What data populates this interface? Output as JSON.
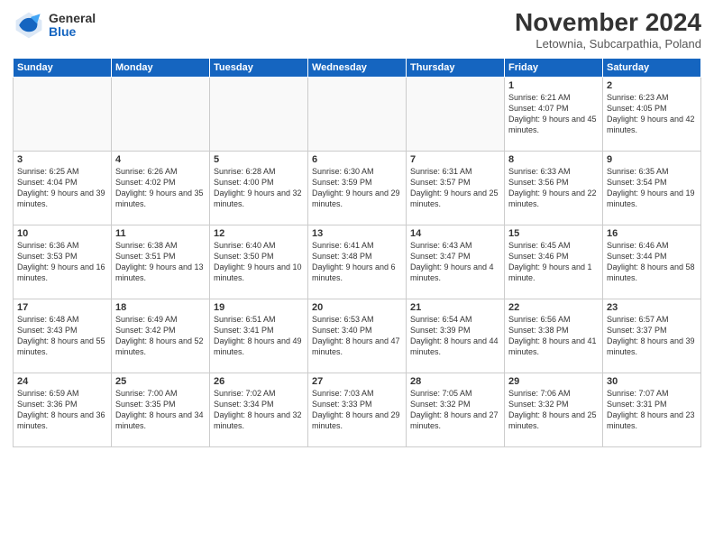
{
  "logo": {
    "general": "General",
    "blue": "Blue"
  },
  "header": {
    "month": "November 2024",
    "location": "Letownia, Subcarpathia, Poland"
  },
  "weekdays": [
    "Sunday",
    "Monday",
    "Tuesday",
    "Wednesday",
    "Thursday",
    "Friday",
    "Saturday"
  ],
  "weeks": [
    [
      {
        "day": "",
        "info": ""
      },
      {
        "day": "",
        "info": ""
      },
      {
        "day": "",
        "info": ""
      },
      {
        "day": "",
        "info": ""
      },
      {
        "day": "",
        "info": ""
      },
      {
        "day": "1",
        "info": "Sunrise: 6:21 AM\nSunset: 4:07 PM\nDaylight: 9 hours and 45 minutes."
      },
      {
        "day": "2",
        "info": "Sunrise: 6:23 AM\nSunset: 4:05 PM\nDaylight: 9 hours and 42 minutes."
      }
    ],
    [
      {
        "day": "3",
        "info": "Sunrise: 6:25 AM\nSunset: 4:04 PM\nDaylight: 9 hours and 39 minutes."
      },
      {
        "day": "4",
        "info": "Sunrise: 6:26 AM\nSunset: 4:02 PM\nDaylight: 9 hours and 35 minutes."
      },
      {
        "day": "5",
        "info": "Sunrise: 6:28 AM\nSunset: 4:00 PM\nDaylight: 9 hours and 32 minutes."
      },
      {
        "day": "6",
        "info": "Sunrise: 6:30 AM\nSunset: 3:59 PM\nDaylight: 9 hours and 29 minutes."
      },
      {
        "day": "7",
        "info": "Sunrise: 6:31 AM\nSunset: 3:57 PM\nDaylight: 9 hours and 25 minutes."
      },
      {
        "day": "8",
        "info": "Sunrise: 6:33 AM\nSunset: 3:56 PM\nDaylight: 9 hours and 22 minutes."
      },
      {
        "day": "9",
        "info": "Sunrise: 6:35 AM\nSunset: 3:54 PM\nDaylight: 9 hours and 19 minutes."
      }
    ],
    [
      {
        "day": "10",
        "info": "Sunrise: 6:36 AM\nSunset: 3:53 PM\nDaylight: 9 hours and 16 minutes."
      },
      {
        "day": "11",
        "info": "Sunrise: 6:38 AM\nSunset: 3:51 PM\nDaylight: 9 hours and 13 minutes."
      },
      {
        "day": "12",
        "info": "Sunrise: 6:40 AM\nSunset: 3:50 PM\nDaylight: 9 hours and 10 minutes."
      },
      {
        "day": "13",
        "info": "Sunrise: 6:41 AM\nSunset: 3:48 PM\nDaylight: 9 hours and 6 minutes."
      },
      {
        "day": "14",
        "info": "Sunrise: 6:43 AM\nSunset: 3:47 PM\nDaylight: 9 hours and 4 minutes."
      },
      {
        "day": "15",
        "info": "Sunrise: 6:45 AM\nSunset: 3:46 PM\nDaylight: 9 hours and 1 minute."
      },
      {
        "day": "16",
        "info": "Sunrise: 6:46 AM\nSunset: 3:44 PM\nDaylight: 8 hours and 58 minutes."
      }
    ],
    [
      {
        "day": "17",
        "info": "Sunrise: 6:48 AM\nSunset: 3:43 PM\nDaylight: 8 hours and 55 minutes."
      },
      {
        "day": "18",
        "info": "Sunrise: 6:49 AM\nSunset: 3:42 PM\nDaylight: 8 hours and 52 minutes."
      },
      {
        "day": "19",
        "info": "Sunrise: 6:51 AM\nSunset: 3:41 PM\nDaylight: 8 hours and 49 minutes."
      },
      {
        "day": "20",
        "info": "Sunrise: 6:53 AM\nSunset: 3:40 PM\nDaylight: 8 hours and 47 minutes."
      },
      {
        "day": "21",
        "info": "Sunrise: 6:54 AM\nSunset: 3:39 PM\nDaylight: 8 hours and 44 minutes."
      },
      {
        "day": "22",
        "info": "Sunrise: 6:56 AM\nSunset: 3:38 PM\nDaylight: 8 hours and 41 minutes."
      },
      {
        "day": "23",
        "info": "Sunrise: 6:57 AM\nSunset: 3:37 PM\nDaylight: 8 hours and 39 minutes."
      }
    ],
    [
      {
        "day": "24",
        "info": "Sunrise: 6:59 AM\nSunset: 3:36 PM\nDaylight: 8 hours and 36 minutes."
      },
      {
        "day": "25",
        "info": "Sunrise: 7:00 AM\nSunset: 3:35 PM\nDaylight: 8 hours and 34 minutes."
      },
      {
        "day": "26",
        "info": "Sunrise: 7:02 AM\nSunset: 3:34 PM\nDaylight: 8 hours and 32 minutes."
      },
      {
        "day": "27",
        "info": "Sunrise: 7:03 AM\nSunset: 3:33 PM\nDaylight: 8 hours and 29 minutes."
      },
      {
        "day": "28",
        "info": "Sunrise: 7:05 AM\nSunset: 3:32 PM\nDaylight: 8 hours and 27 minutes."
      },
      {
        "day": "29",
        "info": "Sunrise: 7:06 AM\nSunset: 3:32 PM\nDaylight: 8 hours and 25 minutes."
      },
      {
        "day": "30",
        "info": "Sunrise: 7:07 AM\nSunset: 3:31 PM\nDaylight: 8 hours and 23 minutes."
      }
    ]
  ]
}
